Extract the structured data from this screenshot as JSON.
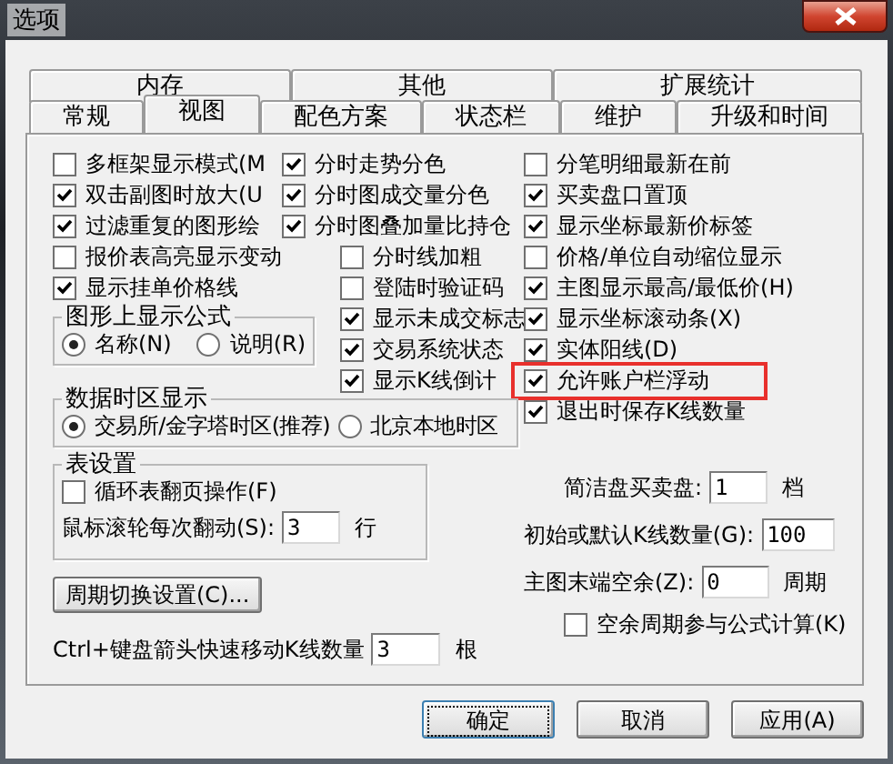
{
  "window": {
    "title": "选项"
  },
  "tabs_row_1": [
    {
      "label": "内存",
      "selected": false
    },
    {
      "label": "其他",
      "selected": false
    },
    {
      "label": "扩展统计",
      "selected": false
    }
  ],
  "tabs_row_2": [
    {
      "label": "常规",
      "selected": false
    },
    {
      "label": "视图",
      "selected": true
    },
    {
      "label": "配色方案",
      "selected": false
    },
    {
      "label": "状态栏",
      "selected": false
    },
    {
      "label": "维护",
      "selected": false
    },
    {
      "label": "升级和时间",
      "selected": false
    }
  ],
  "column_1": [
    {
      "label": "多框架显示模式(M",
      "checked": false
    },
    {
      "label": "双击副图时放大(U",
      "checked": true
    },
    {
      "label": "过滤重复的图形绘",
      "checked": true
    },
    {
      "label": "报价表高亮显示变动",
      "checked": false
    },
    {
      "label": "显示挂单价格线",
      "checked": true
    }
  ],
  "formula_group": {
    "title": "图形上显示公式",
    "options": [
      {
        "label": "名称(N)",
        "selected": true
      },
      {
        "label": "说明(R)",
        "selected": false
      }
    ]
  },
  "column_2": [
    {
      "label": "分时走势分色",
      "checked": true
    },
    {
      "label": "分时图成交量分色",
      "checked": true
    },
    {
      "label": "分时图叠加量比持仓",
      "checked": true
    }
  ],
  "column_2_lower": [
    {
      "label": "分时线加粗",
      "checked": false
    },
    {
      "label": "登陆时验证码",
      "checked": false
    },
    {
      "label": "显示未成交标志",
      "checked": true
    },
    {
      "label": "交易系统状态",
      "checked": true
    },
    {
      "label": "显示K线倒计",
      "checked": true
    }
  ],
  "column_3": [
    {
      "label": "分笔明细最新在前",
      "checked": false,
      "highlighted": false
    },
    {
      "label": "买卖盘口置顶",
      "checked": true,
      "highlighted": false
    },
    {
      "label": "显示坐标最新价标签",
      "checked": true,
      "highlighted": false
    },
    {
      "label": "价格/单位自动缩位显示",
      "checked": false,
      "highlighted": false
    },
    {
      "label": "主图显示最高/最低价(H)",
      "checked": true,
      "highlighted": false
    },
    {
      "label": "显示坐标滚动条(X)",
      "checked": true,
      "highlighted": false
    },
    {
      "label": "实体阳线(D)",
      "checked": true,
      "highlighted": false
    },
    {
      "label": "允许账户栏浮动",
      "checked": true,
      "highlighted": true
    },
    {
      "label": "退出时保存K线数量",
      "checked": true,
      "highlighted": false
    }
  ],
  "timezone_group": {
    "title": "数据时区显示",
    "options": [
      {
        "label": "交易所/金字塔时区(推荐)",
        "selected": true
      },
      {
        "label": "北京本地时区",
        "selected": false
      }
    ]
  },
  "table_group": {
    "title": "表设置",
    "checkbox": {
      "label": "循环表翻页操作(F)",
      "checked": false
    },
    "field": {
      "label": "鼠标滚轮每次翻动(S):",
      "value": "3",
      "unit": "行"
    }
  },
  "period_button": {
    "label": "周期切换设置(C)..."
  },
  "ctrl_field": {
    "label": "Ctrl+键盘箭头快速移动K线数量",
    "value": "3",
    "unit": "根"
  },
  "right_fields": [
    {
      "label": "简洁盘买卖盘:",
      "value": "1",
      "unit": "档"
    },
    {
      "label": "初始或默认K线数量(G):",
      "value": "100"
    },
    {
      "label": "主图末端空余(Z):",
      "value": "0",
      "unit": "周期"
    }
  ],
  "right_checkbox": {
    "label": "空余周期参与公式计算(K)",
    "checked": false
  },
  "buttons": [
    {
      "label": "确定",
      "focused": true
    },
    {
      "label": "取消",
      "focused": false
    },
    {
      "label": "应用(A)",
      "focused": false
    }
  ]
}
